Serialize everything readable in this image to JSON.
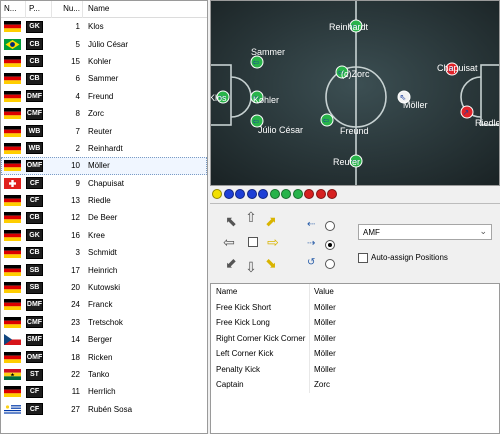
{
  "list": {
    "headers": [
      "N...",
      "P...",
      "Nu...",
      "Name"
    ],
    "rows": [
      {
        "flag": "germany",
        "pos": "GK",
        "num": "1",
        "name": "Klos"
      },
      {
        "flag": "brazil",
        "pos": "CB",
        "num": "5",
        "name": "Júlio César"
      },
      {
        "flag": "germany",
        "pos": "CB",
        "num": "15",
        "name": "Kohler"
      },
      {
        "flag": "germany",
        "pos": "CB",
        "num": "6",
        "name": "Sammer"
      },
      {
        "flag": "germany",
        "pos": "DMF",
        "num": "4",
        "name": "Freund"
      },
      {
        "flag": "germany",
        "pos": "CMF",
        "num": "8",
        "name": "Zorc"
      },
      {
        "flag": "germany",
        "pos": "WB",
        "num": "7",
        "name": "Reuter"
      },
      {
        "flag": "germany",
        "pos": "WB",
        "num": "2",
        "name": "Reinhardt"
      },
      {
        "flag": "germany",
        "pos": "OMF",
        "num": "10",
        "name": "Möller",
        "selected": true
      },
      {
        "flag": "switzerland",
        "pos": "CF",
        "num": "9",
        "name": "Chapuisat"
      },
      {
        "flag": "germany",
        "pos": "CF",
        "num": "13",
        "name": "Riedle"
      },
      {
        "flag": "germany",
        "pos": "CB",
        "num": "12",
        "name": "De Beer"
      },
      {
        "flag": "germany",
        "pos": "GK",
        "num": "16",
        "name": "Kree"
      },
      {
        "flag": "germany",
        "pos": "CB",
        "num": "3",
        "name": "Schmidt"
      },
      {
        "flag": "germany",
        "pos": "SB",
        "num": "17",
        "name": "Heinrich"
      },
      {
        "flag": "germany",
        "pos": "SB",
        "num": "20",
        "name": "Kutowski"
      },
      {
        "flag": "germany",
        "pos": "DMF",
        "num": "24",
        "name": "Franck"
      },
      {
        "flag": "germany",
        "pos": "CMF",
        "num": "23",
        "name": "Tretschok"
      },
      {
        "flag": "czech",
        "pos": "SMF",
        "num": "14",
        "name": "Berger"
      },
      {
        "flag": "germany",
        "pos": "OMF",
        "num": "18",
        "name": "Ricken"
      },
      {
        "flag": "ghana",
        "pos": "ST",
        "num": "22",
        "name": "Tanko"
      },
      {
        "flag": "germany",
        "pos": "CF",
        "num": "11",
        "name": "Herrlich"
      },
      {
        "flag": "uruguay",
        "pos": "CF",
        "num": "27",
        "name": "Rubén Sosa"
      }
    ]
  },
  "pitch": {
    "players": [
      {
        "name": "Klos",
        "team": "green"
      },
      {
        "name": "Sammer",
        "team": "green"
      },
      {
        "name": "Kohler",
        "team": "green"
      },
      {
        "name": "Júlio César",
        "team": "green"
      },
      {
        "name": "Reinhardt",
        "team": "green"
      },
      {
        "name": "(c)Zorc",
        "team": "green"
      },
      {
        "name": "Freund",
        "team": "green"
      },
      {
        "name": "Reuter",
        "team": "green"
      },
      {
        "name": "Möller",
        "team": "white"
      },
      {
        "name": "Chapuisat",
        "team": "red"
      },
      {
        "name": "Riedle",
        "team": "red"
      }
    ]
  },
  "balls": [
    "#f2e000",
    "#1e3fd6",
    "#1e3fd6",
    "#1e3fd6",
    "#1e3fd6",
    "#27b34a",
    "#27b34a",
    "#27b34a",
    "#d62020",
    "#d62020",
    "#d62020"
  ],
  "controls": {
    "position_value": "AMF",
    "auto_assign_label": "Auto-assign Positions"
  },
  "properties": {
    "header": {
      "name": "Name",
      "value": "Value"
    },
    "rows": [
      {
        "name": "Free Kick Short",
        "value": "Möller"
      },
      {
        "name": "Free Kick Long",
        "value": "Möller"
      },
      {
        "name": "Right Corner Kick Corner",
        "value": "Möller"
      },
      {
        "name": "Left Corner Kick",
        "value": "Möller"
      },
      {
        "name": "Penalty Kick",
        "value": "Möller"
      },
      {
        "name": "Captain",
        "value": "Zorc"
      }
    ]
  }
}
